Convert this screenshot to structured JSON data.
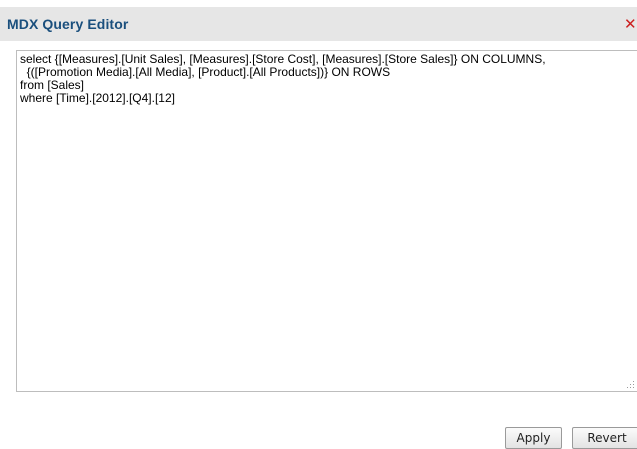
{
  "dialog": {
    "title": "MDX Query Editor",
    "close_icon": "close-x-icon",
    "close_glyph": "✕"
  },
  "editor": {
    "query": "select {[Measures].[Unit Sales], [Measures].[Store Cost], [Measures].[Store Sales]} ON COLUMNS,\n  {([Promotion Media].[All Media], [Product].[All Products])} ON ROWS\nfrom [Sales]\nwhere [Time].[2012].[Q4].[12]"
  },
  "buttons": {
    "apply_label": "Apply",
    "revert_label": "Revert"
  },
  "colors": {
    "title": "#1a4f7d",
    "titlebar_bg": "#e6e6e6",
    "close": "#cc1f1f"
  }
}
